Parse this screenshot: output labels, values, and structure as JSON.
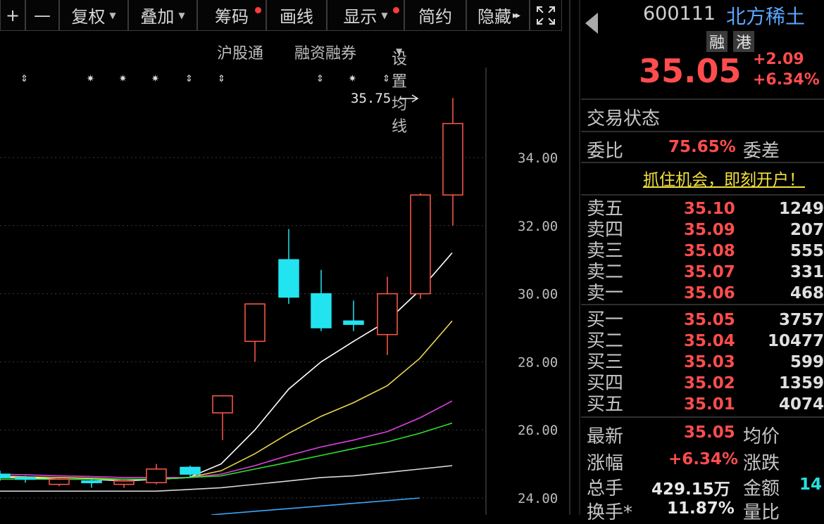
{
  "toolbar": {
    "plus": "+",
    "minus": "—",
    "fuquan": "复权",
    "diejia": "叠加",
    "chouma": "筹码",
    "huaxian": "画线",
    "xianshi": "显示",
    "jianyue": "简约",
    "yincang": "隐藏",
    "more": "▸▸"
  },
  "subbar": {
    "hgt": "沪股通",
    "rzrq": "融资融券",
    "ma_settings": "设置均线"
  },
  "chart_data": {
    "type": "candlestick",
    "price_axis": [
      "34.00",
      "32.00",
      "30.00",
      "28.00",
      "26.00",
      "24.00"
    ],
    "ylim": [
      23.5,
      36.5
    ],
    "high_label": "35.75",
    "candles": [
      {
        "o": 24.7,
        "c": 24.6,
        "h": 24.8,
        "l": 24.5,
        "dir": "down"
      },
      {
        "o": 24.6,
        "c": 24.55,
        "h": 24.65,
        "l": 24.45,
        "dir": "down"
      },
      {
        "o": 24.4,
        "c": 24.55,
        "h": 24.6,
        "l": 24.35,
        "dir": "up"
      },
      {
        "o": 24.5,
        "c": 24.45,
        "h": 24.6,
        "l": 24.3,
        "dir": "down"
      },
      {
        "o": 24.4,
        "c": 24.5,
        "h": 24.55,
        "l": 24.3,
        "dir": "up"
      },
      {
        "o": 24.45,
        "c": 24.85,
        "h": 25.0,
        "l": 24.4,
        "dir": "up"
      },
      {
        "o": 24.9,
        "c": 24.7,
        "h": 24.95,
        "l": 24.6,
        "dir": "down"
      },
      {
        "o": 26.5,
        "c": 27.0,
        "h": 27.0,
        "l": 25.7,
        "dir": "up"
      },
      {
        "o": 28.6,
        "c": 29.7,
        "h": 29.7,
        "l": 28.0,
        "dir": "up"
      },
      {
        "o": 31.0,
        "c": 29.9,
        "h": 31.9,
        "l": 29.7,
        "dir": "down"
      },
      {
        "o": 30.0,
        "c": 29.0,
        "h": 30.7,
        "l": 28.9,
        "dir": "down"
      },
      {
        "o": 29.2,
        "c": 29.1,
        "h": 29.8,
        "l": 28.9,
        "dir": "down"
      },
      {
        "o": 28.8,
        "c": 30.0,
        "h": 30.5,
        "l": 28.2,
        "dir": "up"
      },
      {
        "o": 30.0,
        "c": 32.9,
        "h": 32.95,
        "l": 29.85,
        "dir": "up"
      },
      {
        "o": 32.9,
        "c": 35.0,
        "h": 35.75,
        "l": 32.0,
        "dir": "up"
      }
    ],
    "ma_lines": [
      {
        "name": "MA5",
        "color": "#ffffff",
        "values": [
          24.6,
          24.6,
          24.55,
          24.55,
          24.5,
          24.55,
          24.6,
          25.0,
          26.0,
          27.2,
          28.0,
          28.6,
          29.2,
          30.1,
          31.2
        ]
      },
      {
        "name": "MA10",
        "color": "#e8d44d",
        "values": [
          24.65,
          24.62,
          24.6,
          24.58,
          24.55,
          24.55,
          24.6,
          24.8,
          25.3,
          25.9,
          26.4,
          26.8,
          27.3,
          28.1,
          29.2
        ]
      },
      {
        "name": "MA20",
        "color": "#e040e0",
        "values": [
          24.7,
          24.68,
          24.65,
          24.63,
          24.6,
          24.6,
          24.6,
          24.7,
          24.95,
          25.25,
          25.5,
          25.7,
          25.95,
          26.35,
          26.85
        ]
      },
      {
        "name": "MA30",
        "color": "#2ee02e",
        "values": [
          24.55,
          24.55,
          24.55,
          24.55,
          24.55,
          24.55,
          24.6,
          24.65,
          24.85,
          25.05,
          25.25,
          25.45,
          25.65,
          25.9,
          26.2
        ]
      },
      {
        "name": "MA60",
        "color": "#d8d8d8",
        "values": [
          24.2,
          24.2,
          24.2,
          24.2,
          24.2,
          24.2,
          24.25,
          24.3,
          24.4,
          24.5,
          24.6,
          24.65,
          24.75,
          24.85,
          24.95
        ]
      }
    ],
    "markers": [
      "arrow",
      "star",
      "star",
      "star",
      "arrow",
      "arrow",
      "arrow",
      "star",
      "arrow"
    ]
  },
  "quote": {
    "code": "600111",
    "name": "北方稀土",
    "tag_rong": "融",
    "tag_gang": "港",
    "price": "35.05",
    "change": "+2.09",
    "change_pct": "+6.34%",
    "trade_status": "交易状态",
    "weibi_label": "委比",
    "weibi": "75.65%",
    "weicha_label": "委差",
    "ad": "抓住机会，即刻开户！"
  },
  "orderbook": {
    "asks": [
      {
        "name": "卖五",
        "price": "35.10",
        "vol": "1249"
      },
      {
        "name": "卖四",
        "price": "35.09",
        "vol": "207"
      },
      {
        "name": "卖三",
        "price": "35.08",
        "vol": "555"
      },
      {
        "name": "卖二",
        "price": "35.07",
        "vol": "331"
      },
      {
        "name": "卖一",
        "price": "35.06",
        "vol": "468"
      }
    ],
    "bids": [
      {
        "name": "买一",
        "price": "35.05",
        "vol": "3757"
      },
      {
        "name": "买二",
        "price": "35.04",
        "vol": "10477"
      },
      {
        "name": "买三",
        "price": "35.03",
        "vol": "599"
      },
      {
        "name": "买四",
        "price": "35.02",
        "vol": "1359"
      },
      {
        "name": "买五",
        "price": "35.01",
        "vol": "4074"
      }
    ]
  },
  "stats": {
    "zuixin_label": "最新",
    "zuixin": "35.05",
    "junjia_label": "均价",
    "zhangfu_label": "涨幅",
    "zhangfu": "+6.34%",
    "zhangdie_label": "涨跌",
    "zongshou_label": "总手",
    "zongshou": "429.15万",
    "jine_label": "金额",
    "jine": "14",
    "huanshou_label": "换手*",
    "huanshou": "11.87%",
    "liangbi_label": "量比"
  }
}
